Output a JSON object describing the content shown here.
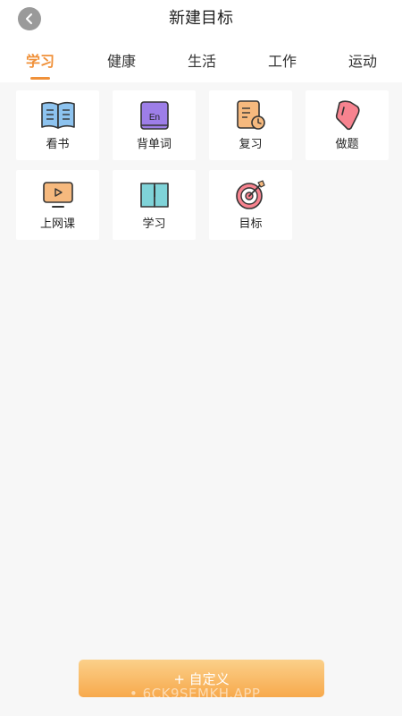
{
  "header": {
    "title": "新建目标"
  },
  "tabs": [
    {
      "label": "学习",
      "active": true
    },
    {
      "label": "健康",
      "active": false
    },
    {
      "label": "生活",
      "active": false
    },
    {
      "label": "工作",
      "active": false
    },
    {
      "label": "运动",
      "active": false
    }
  ],
  "items": [
    {
      "label": "看书",
      "icon": "open-book-icon"
    },
    {
      "label": "背单词",
      "icon": "english-book-icon"
    },
    {
      "label": "复习",
      "icon": "notebook-clock-icon"
    },
    {
      "label": "做题",
      "icon": "pencil-icon"
    },
    {
      "label": "上网课",
      "icon": "monitor-play-icon"
    },
    {
      "label": "学习",
      "icon": "study-book-icon"
    },
    {
      "label": "目标",
      "icon": "target-icon"
    }
  ],
  "footer": {
    "custom_label": "+ 自定义",
    "watermark": "• 6CK9SEMKH.APP"
  },
  "colors": {
    "accent": "#f0913a",
    "button_gradient_top": "#fbd08a",
    "button_gradient_bottom": "#f7a94c"
  }
}
